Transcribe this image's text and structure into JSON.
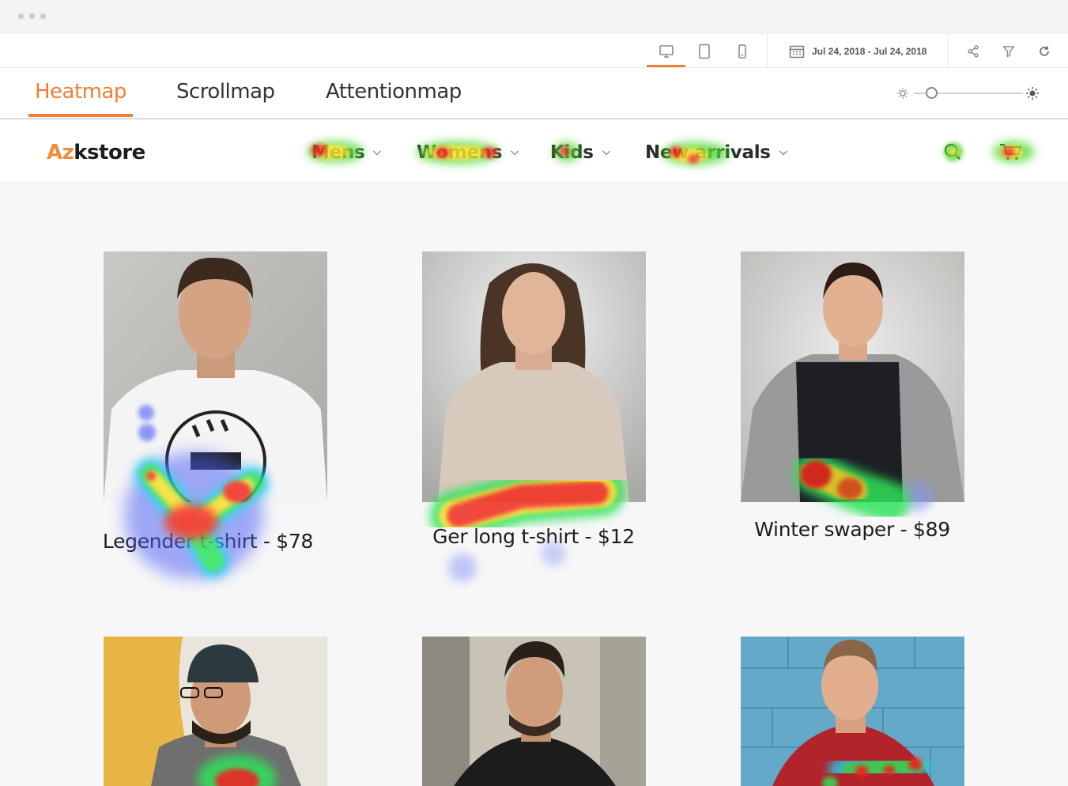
{
  "toolbar": {
    "date_range": "Jul 24, 2018 - Jul 24, 2018"
  },
  "tabs": [
    {
      "label": "Heatmap",
      "active": true
    },
    {
      "label": "Scrollmap",
      "active": false
    },
    {
      "label": "Attentionmap",
      "active": false
    }
  ],
  "store": {
    "logo_accent": "Az",
    "logo_rest": "kstore",
    "nav": [
      "Mens",
      "Womens",
      "Kids",
      "New arrivals"
    ]
  },
  "products": [
    {
      "caption": "Legender t-shirt - $78"
    },
    {
      "caption": "Ger long t-shirt - $12"
    },
    {
      "caption": "Winter swaper - $89"
    },
    {
      "caption": ""
    },
    {
      "caption": ""
    },
    {
      "caption": ""
    }
  ],
  "colors": {
    "accent": "#f07f32",
    "logo_accent": "#ef8e3c"
  }
}
